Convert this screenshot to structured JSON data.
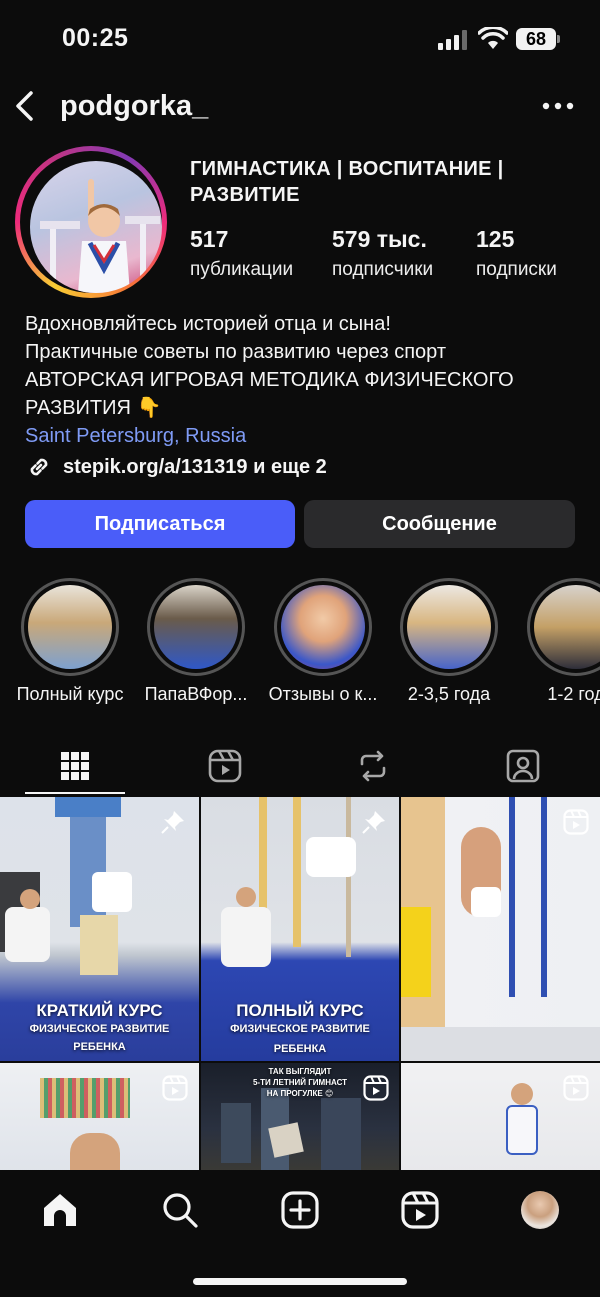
{
  "status_bar": {
    "time": "00:25",
    "battery": "68"
  },
  "header": {
    "username": "podgorka_"
  },
  "profile": {
    "name": "ГИМНАСТИКА | ВОСПИТАНИЕ | РАЗВИТИЕ",
    "stats": [
      {
        "value": "517",
        "label": "публикации"
      },
      {
        "value": "579 тыс.",
        "label": "подписчики"
      },
      {
        "value": "125",
        "label": "подписки"
      }
    ],
    "bio_lines": [
      "Вдохновляйтесь историей отца и сына!",
      "Практичные советы по развитию через спорт",
      "АВТОРСКАЯ ИГРОВАЯ МЕТОДИКА ФИЗИЧЕСКОГО",
      "РАЗВИТИЯ 👇"
    ],
    "location": "Saint Petersburg, Russia",
    "link": "stepik.org/a/131319 и еще 2"
  },
  "buttons": {
    "follow": "Подписаться",
    "message": "Сообщение"
  },
  "highlights": [
    {
      "label": "Полный курс"
    },
    {
      "label": "ПапаВФор..."
    },
    {
      "label": "Отзывы о к..."
    },
    {
      "label": "2-3,5 года"
    },
    {
      "label": "1-2 год"
    }
  ],
  "posts": [
    {
      "caption_title": "КРАТКИЙ КУРС",
      "caption_sub1": "ФИЗИЧЕСКОЕ РАЗВИТИЕ",
      "caption_sub2": "РЕБЕНКА"
    },
    {
      "caption_title": "ПОЛНЫЙ КУРС",
      "caption_sub1": "ФИЗИЧЕСКОЕ РАЗВИТИЕ",
      "caption_sub2": "РЕБЕНКА"
    },
    {
      "caption_title": ""
    },
    {
      "caption_title": ""
    },
    {
      "caption_line1": "ТАК ВЫГЛЯДИТ",
      "caption_line2": "5-ТИ ЛЕТНИЙ ГИМНАСТ",
      "caption_line3": "НА ПРОГУЛКЕ 😊"
    },
    {
      "caption_title": ""
    }
  ],
  "colors": {
    "accent": "#4a5df9",
    "link": "#7f9bf5",
    "background": "#0c0c0c"
  }
}
